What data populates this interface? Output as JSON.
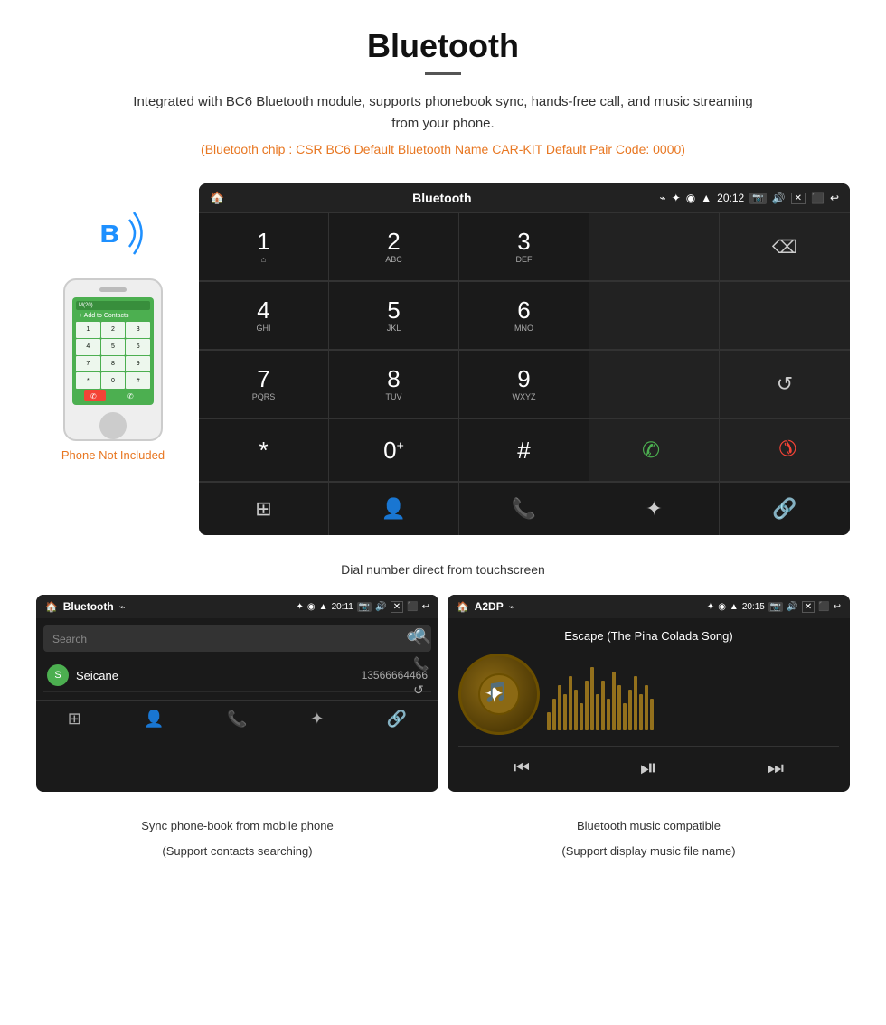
{
  "header": {
    "title": "Bluetooth",
    "description": "Integrated with BC6 Bluetooth module, supports phonebook sync, hands-free call, and music streaming from your phone.",
    "specs": "(Bluetooth chip : CSR BC6    Default Bluetooth Name CAR-KIT    Default Pair Code: 0000)"
  },
  "phone_label": "Phone Not Included",
  "dialpad": {
    "topbar": {
      "left_icon": "🏠",
      "title": "Bluetooth",
      "usb_icon": "⌁",
      "bt_icon": "✦",
      "location_icon": "◉",
      "signal_icon": "▲",
      "time": "20:12",
      "camera_icon": "📷",
      "volume_icon": "🔊",
      "close_icon": "✕",
      "screen_icon": "⬛",
      "back_icon": "↩"
    },
    "keys": [
      {
        "main": "1",
        "sub": "⌂"
      },
      {
        "main": "2",
        "sub": "ABC"
      },
      {
        "main": "3",
        "sub": "DEF"
      },
      {
        "main": "",
        "sub": ""
      },
      {
        "main": "⌫",
        "sub": ""
      }
    ],
    "keys2": [
      {
        "main": "4",
        "sub": "GHI"
      },
      {
        "main": "5",
        "sub": "JKL"
      },
      {
        "main": "6",
        "sub": "MNO"
      },
      {
        "main": "",
        "sub": ""
      },
      {
        "main": "",
        "sub": ""
      }
    ],
    "keys3": [
      {
        "main": "7",
        "sub": "PQRS"
      },
      {
        "main": "8",
        "sub": "TUV"
      },
      {
        "main": "9",
        "sub": "WXYZ"
      },
      {
        "main": "",
        "sub": ""
      },
      {
        "main": "↺",
        "sub": ""
      }
    ],
    "keys4": [
      {
        "main": "*",
        "sub": ""
      },
      {
        "main": "0",
        "sub": "+"
      },
      {
        "main": "#",
        "sub": ""
      },
      {
        "main": "📞",
        "sub": "green"
      },
      {
        "main": "📞",
        "sub": "red"
      }
    ],
    "bottom_nav": [
      "⊞",
      "👤",
      "📞",
      "✦",
      "🔗"
    ]
  },
  "caption_main": "Dial number direct from touchscreen",
  "phonebook": {
    "topbar": {
      "left_icon": "🏠",
      "title": "Bluetooth",
      "usb_icon": "⌁",
      "bt_icon": "✦",
      "location_icon": "◉",
      "signal_icon": "▲",
      "time": "20:11",
      "camera_icon": "📷",
      "volume_icon": "🔊",
      "close_icon": "✕",
      "screen_icon": "⬛",
      "back_icon": "↩"
    },
    "search_placeholder": "Search",
    "contacts": [
      {
        "letter": "S",
        "name": "Seicane",
        "number": "13566664466"
      }
    ],
    "bottom_nav": [
      "⊞",
      "👤",
      "📞",
      "✦",
      "🔗"
    ]
  },
  "music": {
    "topbar": {
      "left_icon": "🏠",
      "title": "A2DP",
      "usb_icon": "⌁",
      "bt_icon": "✦",
      "location_icon": "◉",
      "signal_icon": "▲",
      "time": "20:15",
      "camera_icon": "📷",
      "volume_icon": "🔊",
      "close_icon": "✕",
      "screen_icon": "⬛",
      "back_icon": "↩"
    },
    "song_title": "Escape (The Pina Colada Song)",
    "album_icon": "🎵",
    "controls": [
      "⏮",
      "⏯",
      "⏭"
    ]
  },
  "caption_phonebook_line1": "Sync phone-book from mobile phone",
  "caption_phonebook_line2": "(Support contacts searching)",
  "caption_music_line1": "Bluetooth music compatible",
  "caption_music_line2": "(Support display music file name)",
  "eq_heights": [
    20,
    35,
    50,
    40,
    60,
    45,
    30,
    55,
    70,
    40,
    55,
    35,
    65,
    50,
    30,
    45,
    60,
    40,
    50,
    35
  ]
}
